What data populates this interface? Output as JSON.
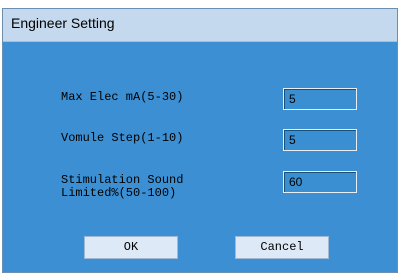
{
  "window": {
    "title": "Engineer Setting"
  },
  "fields": [
    {
      "label": "Max Elec mA(5-30)",
      "value": "5"
    },
    {
      "label": "Vomule Step(1-10)",
      "value": "5"
    },
    {
      "label": "Stimulation Sound\nLimited%(50-100)",
      "value": "60"
    }
  ],
  "buttons": {
    "ok_label": "OK",
    "cancel_label": "Cancel"
  },
  "colors": {
    "dialog_bg": "#3b8fd2",
    "title_bar_bg": "#c4d8ee",
    "button_bg": "#dde9f6"
  }
}
